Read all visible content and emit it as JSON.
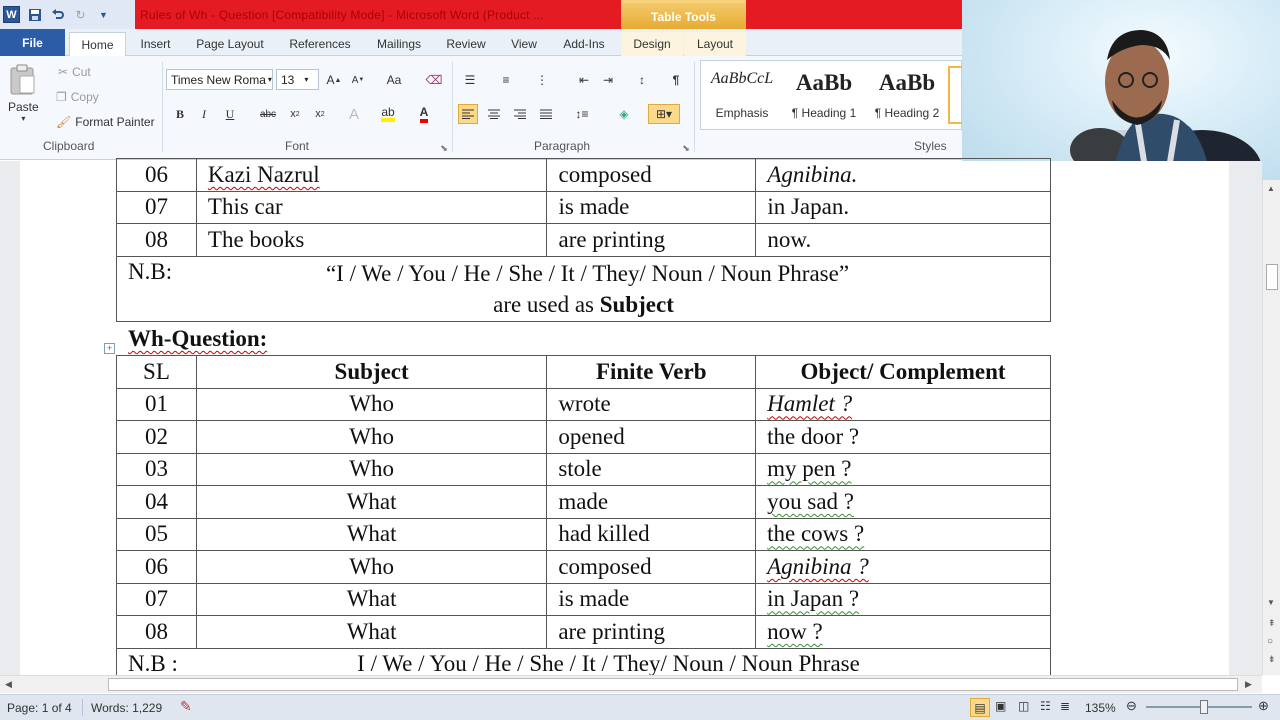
{
  "window": {
    "title": "Rules of Wh - Question [Compatibility Mode] - Microsoft Word (Product ...",
    "context_tab_group": "Table Tools",
    "accent_color": "#e51b24",
    "context_color": "#e6a92f"
  },
  "quick_access": {
    "app_icon": "W",
    "icons": [
      "save-icon",
      "undo-icon",
      "redo-icon",
      "customize-qat-icon"
    ]
  },
  "menu": {
    "tabs": [
      "File",
      "Home",
      "Insert",
      "Page Layout",
      "References",
      "Mailings",
      "Review",
      "View",
      "Add-Ins",
      "Design",
      "Layout"
    ]
  },
  "ribbon": {
    "clipboard": {
      "paste": "Paste",
      "cut": "Cut",
      "copy": "Copy",
      "format_painter": "Format Painter",
      "label": "Clipboard"
    },
    "font": {
      "family": "Times New Roma",
      "size": "13",
      "label": "Font"
    },
    "paragraph": {
      "label": "Paragraph"
    },
    "styles": {
      "label": "Styles",
      "items": [
        {
          "preview": "AaBbCcL",
          "name": "Emphasis"
        },
        {
          "preview": "AaBb",
          "name": "¶ Heading 1"
        },
        {
          "preview": "AaBb",
          "name": "¶ Heading 2"
        }
      ]
    }
  },
  "document": {
    "top_table_rows": [
      {
        "sl": "06",
        "subject": "Kazi Nazrul",
        "verb": "composed",
        "object": "Agnibina."
      },
      {
        "sl": "07",
        "subject": "This car",
        "verb": "is made",
        "object": "in Japan."
      },
      {
        "sl": "08",
        "subject": "The books",
        "verb": "are printing",
        "object": "now."
      }
    ],
    "top_note": {
      "prefix": "N.B:",
      "line1": "“I / We / You / He / She / It / They/ Noun / Noun Phrase”",
      "line2_prefix": "are used as",
      "line2_bold": "Subject"
    },
    "heading": "Wh-Question:",
    "wh_table": {
      "headers": [
        "SL",
        "Subject",
        "Finite Verb",
        "Object/ Complement"
      ],
      "rows": [
        {
          "sl": "01",
          "subject": "Who",
          "verb": "wrote",
          "object": "Hamlet ?"
        },
        {
          "sl": "02",
          "subject": "Who",
          "verb": "opened",
          "object": "the door ?"
        },
        {
          "sl": "03",
          "subject": "Who",
          "verb": "stole",
          "object": "my pen ?"
        },
        {
          "sl": "04",
          "subject": "What",
          "verb": "made",
          "object": "you sad ?"
        },
        {
          "sl": "05",
          "subject": "What",
          "verb": "had killed",
          "object": "the cows ?"
        },
        {
          "sl": "06",
          "subject": "Who",
          "verb": "composed",
          "object": "Agnibina ?"
        },
        {
          "sl": "07",
          "subject": "What",
          "verb": "is made",
          "object": "in Japan ?"
        },
        {
          "sl": "08",
          "subject": "What",
          "verb": "are printing",
          "object": "now ?"
        }
      ],
      "note_prefix": "N.B :",
      "note_text": "I / We / You / He / She / It / They/ Noun / Noun Phrase"
    }
  },
  "status": {
    "page": "Page: 1 of 4",
    "words": "Words: 1,229",
    "zoom": "135%"
  }
}
